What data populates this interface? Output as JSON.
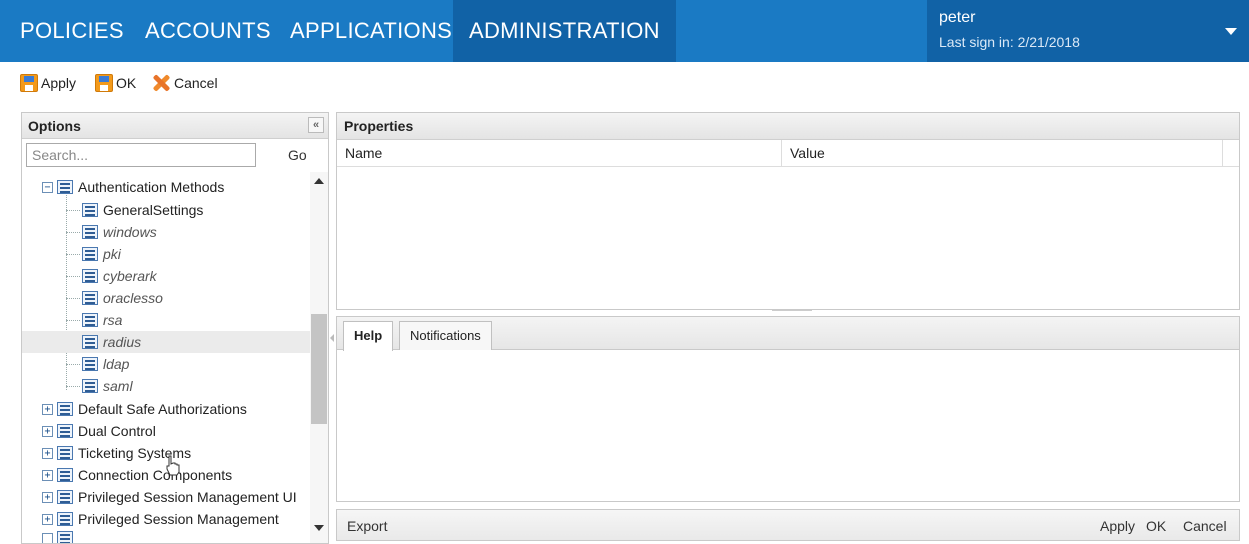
{
  "nav": {
    "items": [
      "POLICIES",
      "ACCOUNTS",
      "APPLICATIONS",
      "ADMINISTRATION"
    ],
    "active_index": 3
  },
  "user": {
    "name": "peter",
    "last_sign_in": "Last sign in:  2/21/2018"
  },
  "toolbar": {
    "apply_label": "Apply",
    "ok_label": "OK",
    "cancel_label": "Cancel"
  },
  "options": {
    "title": "Options",
    "collapse_glyph": "«",
    "search_placeholder": "Search...",
    "go_label": "Go",
    "tree": {
      "root": {
        "label": "Authentication Methods",
        "expanded": true
      },
      "children": [
        "GeneralSettings",
        "windows",
        "pki",
        "cyberark",
        "oraclesso",
        "rsa",
        "radius",
        "ldap",
        "saml"
      ],
      "hovered_child": "radius",
      "siblings": [
        "Default Safe Authorizations",
        "Dual Control",
        "Ticketing Systems",
        "Connection Components",
        "Privileged Session Management UI",
        "Privileged Session Management"
      ],
      "expand_glyph_open": "−",
      "expand_glyph_closed": "+"
    }
  },
  "properties": {
    "title": "Properties",
    "columns": [
      "Name",
      "Value"
    ]
  },
  "help": {
    "tabs": [
      "Help",
      "Notifications"
    ],
    "active_tab": "Help"
  },
  "footer": {
    "export_label": "Export",
    "apply_label": "Apply",
    "ok_label": "OK",
    "cancel_label": "Cancel"
  },
  "colors": {
    "nav_bg": "#1a7ac4",
    "nav_active_bg": "#1162a6"
  }
}
